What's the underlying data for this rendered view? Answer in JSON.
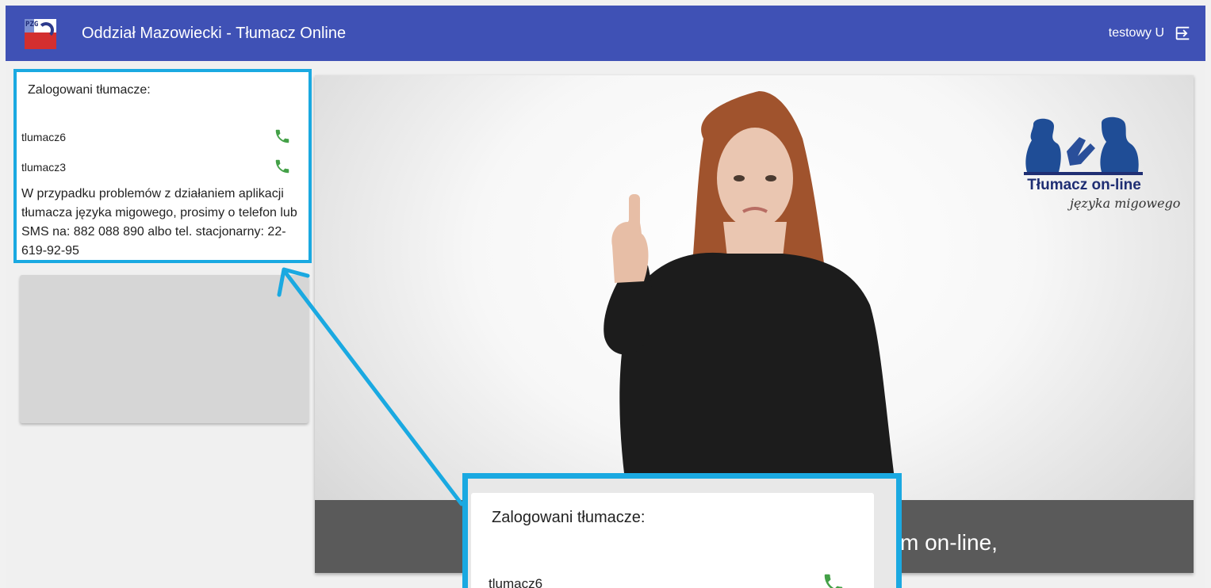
{
  "header": {
    "title": "Oddział Mazowiecki - Tłumacz Online",
    "user": "testowy U",
    "logo_text": "PZG",
    "color": "#3f51b5"
  },
  "sidebar": {
    "heading": "Zalogowani tłumacze:",
    "interpreters": [
      {
        "name": "tlumacz6",
        "icon": "phone-icon"
      },
      {
        "name": "tlumacz3",
        "icon": "phone-icon"
      }
    ],
    "info": "W przypadku problemów z działaniem aplikacji tłumacza języka migowego, prosimy o telefon lub SMS na: 882 088 890 albo tel. stacjonarny: 22-619-92-95"
  },
  "video": {
    "caption": "m on-line,",
    "brand_name": "Tłumacz on-line",
    "brand_sub": "języka migowego"
  },
  "zoom": {
    "heading": "Zalogowani tłumacze:",
    "first_name": "tlumacz6"
  },
  "colors": {
    "highlight": "#1aa9e1",
    "phone": "#43a047"
  }
}
